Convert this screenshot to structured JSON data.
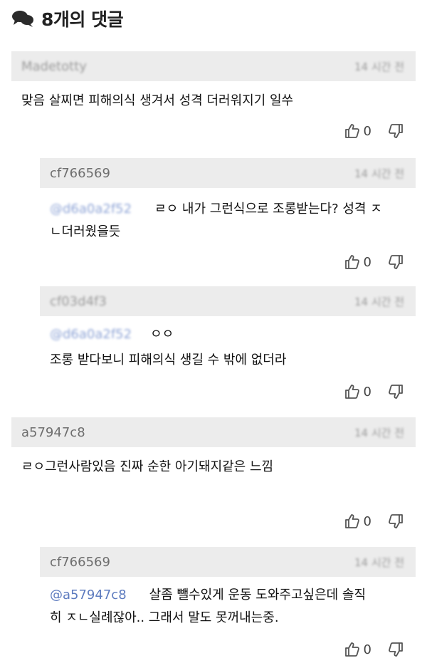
{
  "header": {
    "title": "8개의 댓글"
  },
  "comments": [
    {
      "user": "Madetotty",
      "time": "14 시간 전",
      "text": "맞음 살찌면 피해의식 생겨서 성격 더러워지기 일쑤",
      "likes": "0"
    },
    {
      "user": "cf766569",
      "time": "14 시간 전",
      "mention": "@d6a0a2f52",
      "text_line1": "ㄹㅇ 내가 그런식으로 조롱받는다? 성격 ㅈ",
      "text_line2": "ㄴ더러웠을듯",
      "likes": "0"
    },
    {
      "user": "cf03d4f3",
      "time": "14 시간 전",
      "mention": "@d6a0a2f52",
      "text_line1": "ㅇㅇ",
      "text_line2": "조롱 받다보니 피해의식 생길 수 밖에 없더라",
      "likes": "0"
    },
    {
      "user": "a57947c8",
      "time": "14 시간 전",
      "text": "ㄹㅇ그런사람있음 진짜 순한 아기돼지같은 느낌",
      "likes": "0"
    },
    {
      "user": "cf766569",
      "time": "14 시간 전",
      "mention": "@a57947c8",
      "text_line1": "살좀 뺄수있게 운동 도와주고싶은데 솔직",
      "text_line2": "히 ㅈㄴ실례잖아.. 그래서 말도 못꺼내는중.",
      "likes": "0"
    }
  ]
}
